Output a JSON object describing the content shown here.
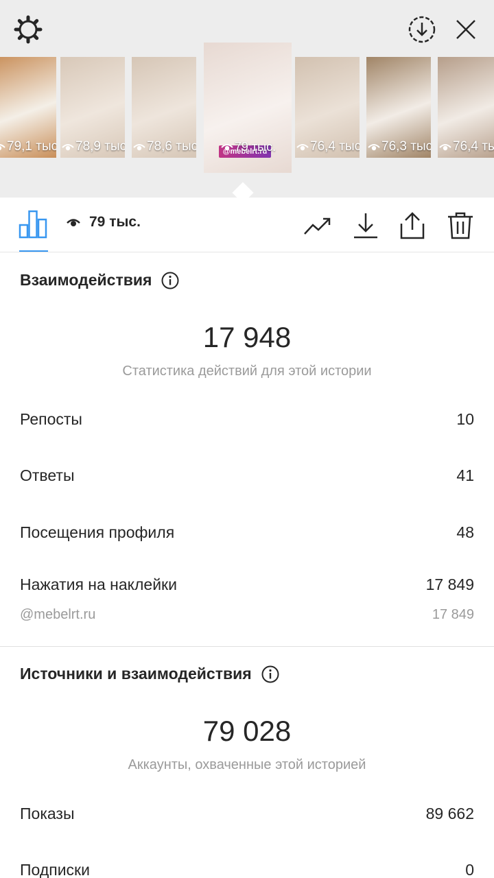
{
  "stories": [
    {
      "views": "79,1 тыс.",
      "colors": [
        "#c98f5a",
        "#f4efe7"
      ]
    },
    {
      "views": "78,9 тыс.",
      "colors": [
        "#d8c8b8",
        "#efe6dd"
      ]
    },
    {
      "views": "78,6 тыс.",
      "colors": [
        "#d6c6b6",
        "#eee5dc"
      ]
    },
    {
      "views": "79 тыс.",
      "colors": [
        "#e7d9d2",
        "#f7f1ee"
      ],
      "selected": true,
      "sticker": "@mebelrt.ru"
    },
    {
      "views": "76,4 тыс.",
      "colors": [
        "#d2c1b0",
        "#ebe1d7"
      ]
    },
    {
      "views": "76,3 тыс.",
      "colors": [
        "#a08466",
        "#f2ece6"
      ]
    },
    {
      "views": "76,4 тыс.",
      "colors": [
        "#b69e8a",
        "#f1ebe5"
      ]
    }
  ],
  "toolbar": {
    "views": "79 тыс."
  },
  "interactions": {
    "title": "Взаимодействия",
    "total": "17 948",
    "caption": "Статистика действий для этой истории",
    "rows": [
      {
        "label": "Репосты",
        "value": "10"
      },
      {
        "label": "Ответы",
        "value": "41"
      },
      {
        "label": "Посещения профиля",
        "value": "48"
      },
      {
        "label": "Нажатия на наклейки",
        "value": "17 849"
      }
    ],
    "sub_row": {
      "label": "@mebelrt.ru",
      "value": "17 849"
    }
  },
  "discovery": {
    "title": "Источники и взаимодействия",
    "total": "79 028",
    "caption": "Аккаунты, охваченные этой историей",
    "rows": [
      {
        "label": "Показы",
        "value": "89 662"
      },
      {
        "label": "Подписки",
        "value": "0"
      }
    ]
  },
  "colors": {
    "accent": "#3897f0",
    "text": "#262626",
    "muted": "#9a9a9a",
    "top_bg": "#ededed"
  },
  "icons": [
    "settings-icon",
    "save-story-icon",
    "close-icon",
    "bar-chart-icon",
    "eye-icon",
    "trend-icon",
    "download-icon",
    "share-icon",
    "trash-icon",
    "info-icon"
  ]
}
